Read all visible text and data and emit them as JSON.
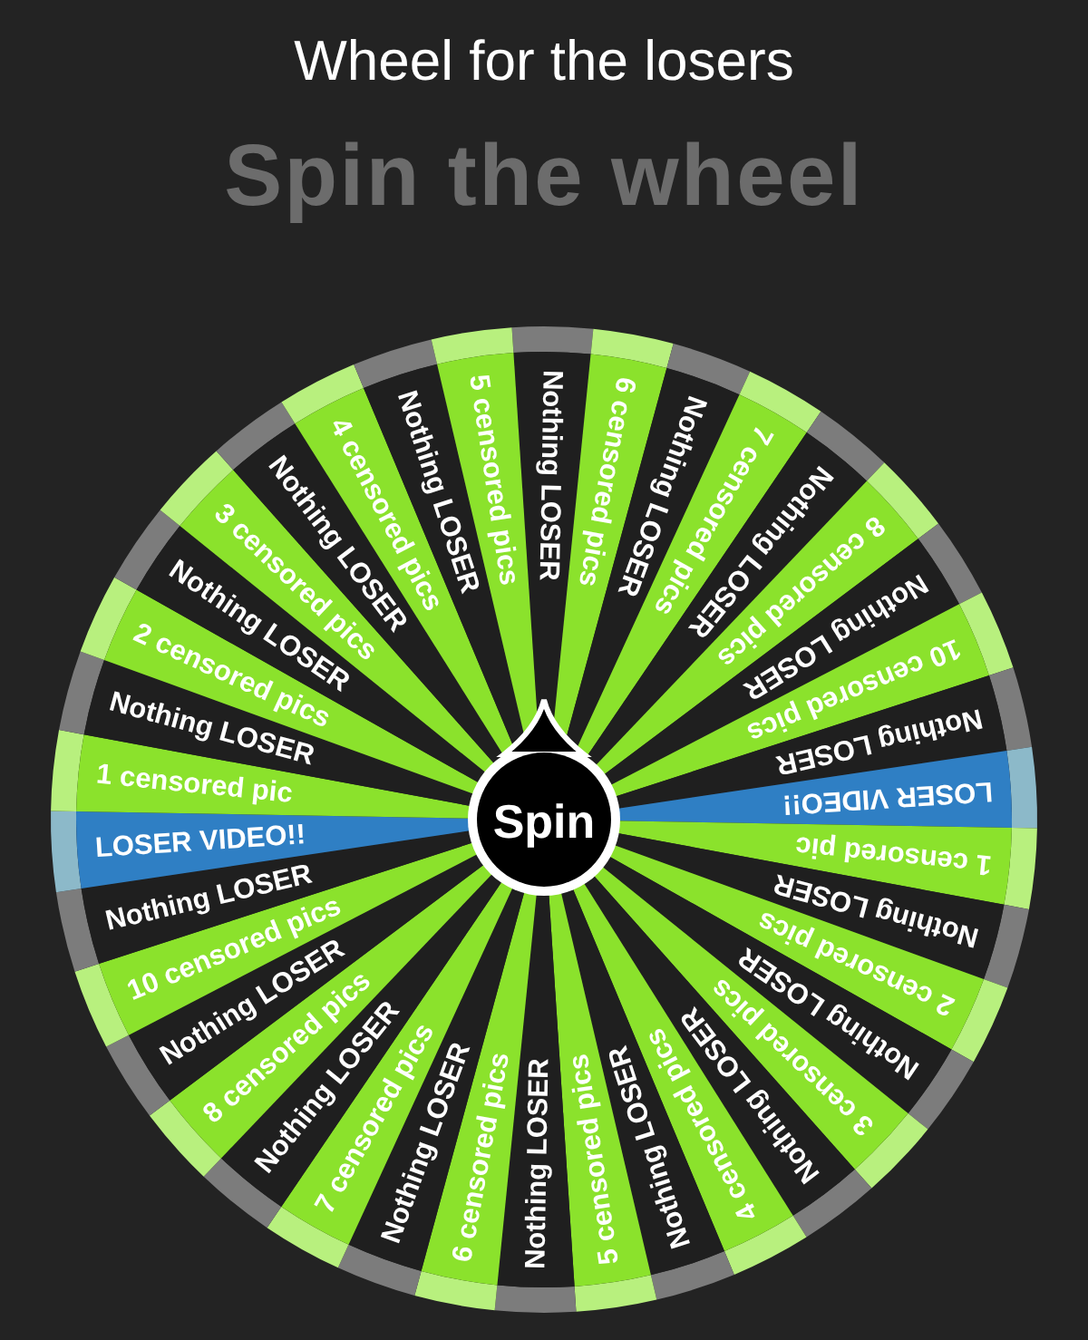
{
  "title": "Wheel for the losers",
  "heading": "Spin the wheel",
  "wheel": {
    "spin_button": "Spin",
    "segments": [
      {
        "label": "Nothing LOSER",
        "kind": "nothing"
      },
      {
        "label": "6 censored pics",
        "kind": "prize"
      },
      {
        "label": "Nothing LOSER",
        "kind": "nothing"
      },
      {
        "label": "7 censored pics",
        "kind": "prize"
      },
      {
        "label": "Nothing LOSER",
        "kind": "nothing"
      },
      {
        "label": "8 censored pics",
        "kind": "prize"
      },
      {
        "label": "Nothing LOSER",
        "kind": "nothing"
      },
      {
        "label": "10 censored pics",
        "kind": "prize"
      },
      {
        "label": "Nothing LOSER",
        "kind": "nothing"
      },
      {
        "label": "LOSER VIDEO!!",
        "kind": "video"
      },
      {
        "label": "1 censored pic",
        "kind": "prize"
      },
      {
        "label": "Nothing LOSER",
        "kind": "nothing"
      },
      {
        "label": "2 censored pics",
        "kind": "prize"
      },
      {
        "label": "Nothing LOSER",
        "kind": "nothing"
      },
      {
        "label": "3 censored pics",
        "kind": "prize"
      },
      {
        "label": "Nothing LOSER",
        "kind": "nothing"
      },
      {
        "label": "4 censored pics",
        "kind": "prize"
      },
      {
        "label": "Nothing LOSER",
        "kind": "nothing"
      },
      {
        "label": "5 censored pics",
        "kind": "prize"
      },
      {
        "label": "Nothing LOSER",
        "kind": "nothing"
      },
      {
        "label": "6 censored pics",
        "kind": "prize"
      },
      {
        "label": "Nothing LOSER",
        "kind": "nothing"
      },
      {
        "label": "7 censored pics",
        "kind": "prize"
      },
      {
        "label": "Nothing LOSER",
        "kind": "nothing"
      },
      {
        "label": "8 censored pics",
        "kind": "prize"
      },
      {
        "label": "Nothing LOSER",
        "kind": "nothing"
      },
      {
        "label": "10 censored pics",
        "kind": "prize"
      },
      {
        "label": "Nothing LOSER",
        "kind": "nothing"
      },
      {
        "label": "LOSER VIDEO!!",
        "kind": "video"
      },
      {
        "label": "1 censored pic",
        "kind": "prize"
      },
      {
        "label": "Nothing LOSER",
        "kind": "nothing"
      },
      {
        "label": "2 censored pics",
        "kind": "prize"
      },
      {
        "label": "Nothing LOSER",
        "kind": "nothing"
      },
      {
        "label": "3 censored pics",
        "kind": "prize"
      },
      {
        "label": "Nothing LOSER",
        "kind": "nothing"
      },
      {
        "label": "4 censored pics",
        "kind": "prize"
      },
      {
        "label": "Nothing LOSER",
        "kind": "nothing"
      },
      {
        "label": "5 censored pics",
        "kind": "prize"
      }
    ]
  }
}
